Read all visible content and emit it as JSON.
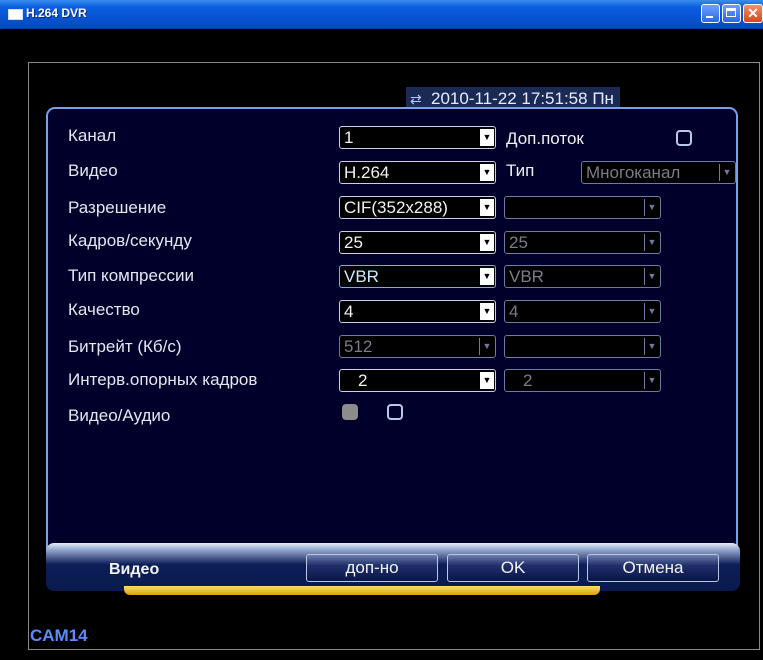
{
  "window": {
    "title": "H.264 DVR"
  },
  "osd": {
    "datetime": "2010-11-22 17:51:58 Пн",
    "camera": "CAM14"
  },
  "form": {
    "labels": {
      "channel": "Канал",
      "video": "Видео",
      "resolution": "Разрешение",
      "fps": "Кадров/секунду",
      "compression": "Тип компрессии",
      "quality": "Качество",
      "bitrate": "Битрейт (Кб/с)",
      "iframe_interval": "Интерв.опорных кадров",
      "video_audio": "Видео/Аудио"
    },
    "main": {
      "channel": "1",
      "video": "H.264",
      "resolution": "CIF(352x288)",
      "fps": "25",
      "compression": "VBR",
      "quality": "4",
      "bitrate": "512",
      "iframe_interval": "2"
    },
    "extra_stream_label": "Доп.поток",
    "type_label": "Тип",
    "type_value": "Многоканал",
    "sub": {
      "resolution": "",
      "fps": "25",
      "compression": "VBR",
      "quality": "4",
      "bitrate": "",
      "iframe_interval": "2"
    }
  },
  "footer": {
    "tab": "Видео",
    "advanced": "доп-но",
    "ok": "OK",
    "cancel": "Отмена"
  }
}
